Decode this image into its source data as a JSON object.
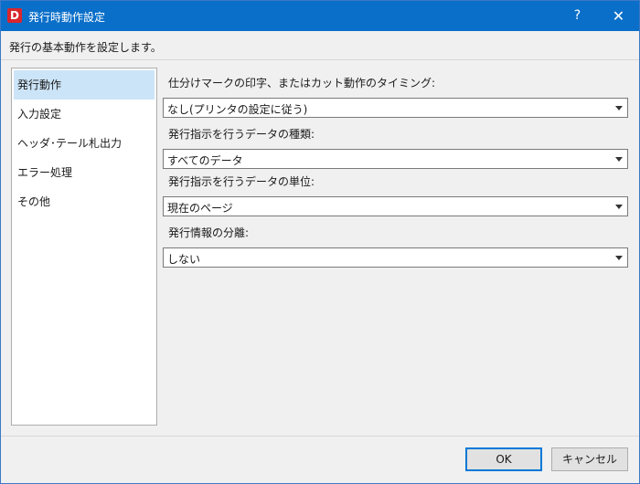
{
  "window": {
    "app_icon_letter": "D",
    "title": "発行時動作設定",
    "help_glyph": "?",
    "close_glyph": "✕"
  },
  "subtitle": "発行の基本動作を設定します。",
  "sidebar": {
    "items": [
      {
        "label": "発行動作",
        "selected": true
      },
      {
        "label": "入力設定",
        "selected": false
      },
      {
        "label": "ヘッダ･テール札出力",
        "selected": false
      },
      {
        "label": "エラー処理",
        "selected": false
      },
      {
        "label": "その他",
        "selected": false
      }
    ]
  },
  "fields": [
    {
      "label": "仕分けマークの印字、またはカット動作のタイミング:",
      "value": "なし(プリンタの設定に従う)"
    },
    {
      "label": "発行指示を行うデータの種類:",
      "value": "すべてのデータ"
    },
    {
      "label": "発行指示を行うデータの単位:",
      "value": "現在のページ"
    },
    {
      "label": "発行情報の分離:",
      "value": "しない"
    }
  ],
  "footer": {
    "ok_label": "OK",
    "cancel_label": "キャンセル"
  },
  "colors": {
    "titlebar": "#0a6fc9",
    "selected_item": "#cce4f7",
    "default_button_border": "#0078d7"
  }
}
